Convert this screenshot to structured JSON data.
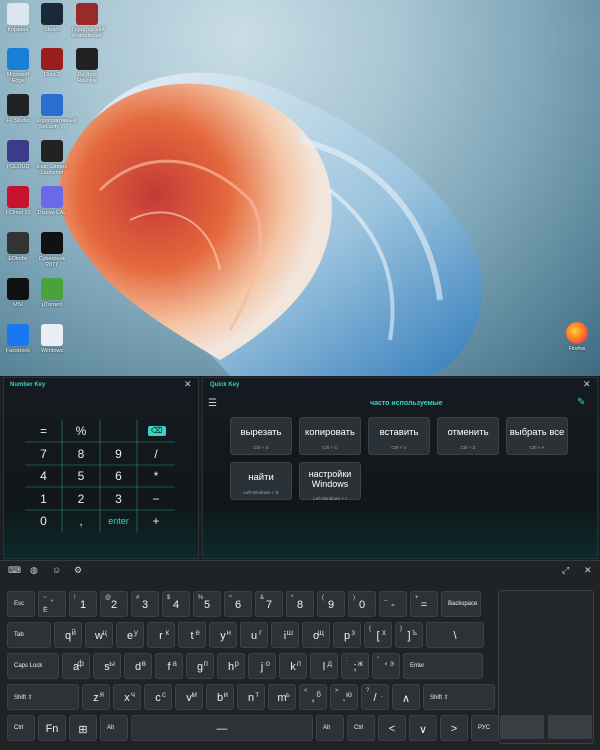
{
  "desktop": {
    "icons": [
      {
        "label": "Корзина",
        "color": "#dbe6ef"
      },
      {
        "label": "Steam",
        "color": "#1b2838"
      },
      {
        "label": "Герцгофский Ковбойский",
        "color": "#9a2a2a"
      },
      {
        "label": "Microsoft Edge",
        "color": "#1a7fd6"
      },
      {
        "label": "Dota 2",
        "color": "#9b1d1d"
      },
      {
        "label": "DaVinci Resolve",
        "color": "#222"
      },
      {
        "label": "FL Studio",
        "color": "#222"
      },
      {
        "label": "Корпоративный Security ...",
        "color": "#2a6fcf"
      },
      {
        "label": "PCLOUD",
        "color": "#3b3b8c"
      },
      {
        "label": "Epic Games Launcher",
        "color": "#222"
      },
      {
        "label": "FCimal 10",
        "color": "#c4122f"
      },
      {
        "label": "DisplayCAL",
        "color": "#6a6ae8"
      },
      {
        "label": "EDindle",
        "color": "#333"
      },
      {
        "label": "Cyberpunk 2077",
        "color": "#111"
      },
      {
        "label": "MSI",
        "color": "#111"
      },
      {
        "label": "µTorrent",
        "color": "#4aa23a"
      },
      {
        "label": "Facebook",
        "color": "#1877f2"
      },
      {
        "label": "Windows",
        "color": "#e8eef2"
      }
    ],
    "firefox_label": "Firefox"
  },
  "number_key": {
    "title": "Number Key",
    "close": "✕",
    "keys": [
      "=",
      "%",
      "⌫",
      "7",
      "8",
      "9",
      "/",
      "4",
      "5",
      "6",
      "*",
      "1",
      "2",
      "3",
      "−",
      "0",
      ",",
      "enter",
      "+"
    ]
  },
  "quick_key": {
    "title": "Quick Key",
    "close": "✕",
    "section_title": "часто используемые",
    "edit_icon": "edit-icon",
    "list_icon": "list-icon",
    "buttons": [
      {
        "label": "вырезать",
        "shortcut": "Ctrl + X"
      },
      {
        "label": "копировать",
        "shortcut": "Ctrl + C"
      },
      {
        "label": "вставить",
        "shortcut": "Ctrl + V"
      },
      {
        "label": "отменить",
        "shortcut": "Ctrl + Z"
      },
      {
        "label": "выбрать все",
        "shortcut": "Ctrl + A"
      },
      {
        "label": "найти",
        "shortcut": "Left Windows + S"
      },
      {
        "label": "настройки Windows",
        "shortcut": "Left Windows + I"
      }
    ]
  },
  "keyboard": {
    "toolbar_icons": [
      "keyboard-icon",
      "globe-icon",
      "emoji-icon",
      "settings-icon"
    ],
    "right_icons": [
      "resize-icon",
      "close-icon"
    ],
    "row1": [
      {
        "m": "Esc"
      },
      {
        "t": "~",
        "b": "Ё",
        "m": "`"
      },
      {
        "t": "!",
        "m": "1"
      },
      {
        "t": "@",
        "m": "2"
      },
      {
        "t": "#",
        "m": "3"
      },
      {
        "t": "$",
        "m": "4"
      },
      {
        "t": "%",
        "m": "5"
      },
      {
        "t": "^",
        "m": "6"
      },
      {
        "t": "&",
        "m": "7"
      },
      {
        "t": "*",
        "m": "8"
      },
      {
        "t": "(",
        "m": "9"
      },
      {
        "t": ")",
        "m": "0"
      },
      {
        "t": "_",
        "m": "-"
      },
      {
        "t": "+",
        "m": "="
      },
      {
        "m": "Backspace"
      }
    ],
    "row2": [
      {
        "m": "Tab"
      },
      {
        "m": "q",
        "r": "й"
      },
      {
        "m": "w",
        "r": "ц"
      },
      {
        "m": "e",
        "r": "у"
      },
      {
        "m": "r",
        "r": "к"
      },
      {
        "m": "t",
        "r": "е"
      },
      {
        "m": "y",
        "r": "н"
      },
      {
        "m": "u",
        "r": "г"
      },
      {
        "m": "i",
        "r": "ш"
      },
      {
        "m": "o",
        "r": "щ"
      },
      {
        "m": "p",
        "r": "з"
      },
      {
        "t": "{",
        "m": "[",
        "r": "х"
      },
      {
        "t": "}",
        "m": "]",
        "r": "ъ"
      },
      {
        "m": "\\"
      }
    ],
    "row3": [
      {
        "m": "Caps Lock"
      },
      {
        "m": "a",
        "r": "ф"
      },
      {
        "m": "s",
        "r": "ы"
      },
      {
        "m": "d",
        "r": "в"
      },
      {
        "m": "f",
        "r": "а"
      },
      {
        "m": "g",
        "r": "п"
      },
      {
        "m": "h",
        "r": "р"
      },
      {
        "m": "j",
        "r": "о"
      },
      {
        "m": "k",
        "r": "л"
      },
      {
        "m": "l",
        "r": "д"
      },
      {
        "t": ":",
        "m": ";",
        "r": "ж"
      },
      {
        "t": "\"",
        "m": "'",
        "r": "э"
      },
      {
        "m": "Enter"
      }
    ],
    "row4": [
      {
        "m": "Shift ⇧"
      },
      {
        "m": "z",
        "r": "я"
      },
      {
        "m": "x",
        "r": "ч"
      },
      {
        "m": "c",
        "r": "с"
      },
      {
        "m": "v",
        "r": "м"
      },
      {
        "m": "b",
        "r": "и"
      },
      {
        "m": "n",
        "r": "т"
      },
      {
        "m": "m",
        "r": "ь"
      },
      {
        "t": "<",
        "m": ",",
        "r": "б"
      },
      {
        "t": ">",
        "m": ".",
        "r": "ю"
      },
      {
        "t": "?",
        "m": "/",
        "r": "."
      },
      {
        "m": "∧"
      },
      {
        "m": "Shift ⇧"
      }
    ],
    "row5": [
      {
        "m": "Ctrl"
      },
      {
        "m": "Fn"
      },
      {
        "m": "⊞"
      },
      {
        "m": "Alt"
      },
      {
        "m": "—"
      },
      {
        "m": "Alt"
      },
      {
        "m": "Ctrl"
      },
      {
        "m": "<"
      },
      {
        "m": "∨"
      },
      {
        "m": ">"
      },
      {
        "m": "РУС"
      }
    ]
  }
}
